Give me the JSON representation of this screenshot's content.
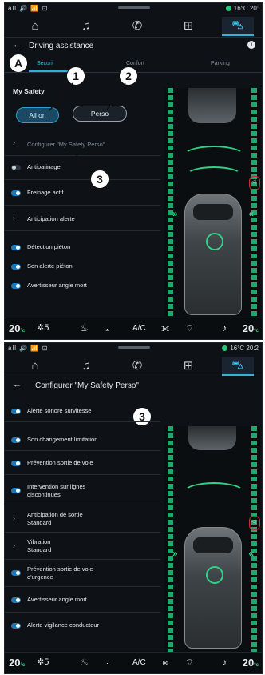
{
  "screen1": {
    "status": {
      "left": "all 🔊 📶 ⊡",
      "temp": "16°C",
      "time": "20:"
    },
    "header": {
      "back": "←",
      "title": "Driving assistance",
      "info": "i"
    },
    "tabs": [
      "Sécuri",
      "Confort",
      "Parking"
    ],
    "callout_a": "A",
    "section_title": "My Safety",
    "pills": {
      "all_on": "All on",
      "perso": "Perso"
    },
    "callouts": [
      "1",
      "2",
      "3"
    ],
    "items": [
      {
        "label": "Configurer \"My Safety Perso\"",
        "type": "chevron",
        "dim": true
      },
      {
        "label": "Antipatinage",
        "type": "toggle",
        "on": false
      },
      {
        "label": "Freinage actif",
        "type": "toggle",
        "on": true
      },
      {
        "label": "Anticipation alerte",
        "type": "chevron"
      },
      {
        "label": "Détection piéton",
        "type": "toggle",
        "on": true
      },
      {
        "label": "Son alerte piéton",
        "type": "toggle",
        "on": true
      },
      {
        "label": "Avertisseur angle mort",
        "type": "toggle",
        "on": true
      }
    ],
    "bottom": {
      "temp_l": "20",
      "temp_l_unit": "°c",
      "temp_l_sub": "ECO",
      "fan": "5",
      "ac": "A/C",
      "temp_r": "20",
      "temp_r_unit": "°c",
      "temp_r_sub": "ECO"
    }
  },
  "screen2": {
    "status": {
      "left": "all 🔊 📶 ⊡",
      "temp": "16°C",
      "time": "20:2"
    },
    "header": {
      "back": "←",
      "title": "Configurer \"My Safety Perso\""
    },
    "callout": "3",
    "items": [
      {
        "label": "Alerte sonore survitesse",
        "type": "toggle",
        "on": true
      },
      {
        "label": "Son changement limitation",
        "type": "toggle",
        "on": true
      },
      {
        "label": "Prévention sortie de voie",
        "type": "toggle",
        "on": true
      },
      {
        "label": "Intervention sur lignes",
        "label2": "discontinues",
        "type": "toggle",
        "on": true
      },
      {
        "label": "Anticipation de sortie",
        "label2": "Standard",
        "type": "chevron"
      },
      {
        "label": "Vibration",
        "label2": "Standard",
        "type": "chevron"
      },
      {
        "label": "Prévention sortie de voie",
        "label2": "d'urgence",
        "type": "toggle",
        "on": true
      },
      {
        "label": "Avertisseur angle mort",
        "type": "toggle",
        "on": true
      },
      {
        "label": "Alerte vigilance conducteur",
        "type": "toggle",
        "on": true
      }
    ],
    "bottom": {
      "temp_l": "20",
      "temp_l_unit": "°c",
      "temp_l_sub": "ECO",
      "fan": "5",
      "ac": "A/C",
      "temp_r": "20",
      "temp_r_unit": "°c",
      "temp_r_sub": "ECO"
    }
  },
  "nav_icons": [
    "home-icon",
    "music-icon",
    "phone-icon",
    "apps-icon",
    "car-icon"
  ],
  "accent": "#2fb5d8",
  "lane_color": "#23c37d"
}
